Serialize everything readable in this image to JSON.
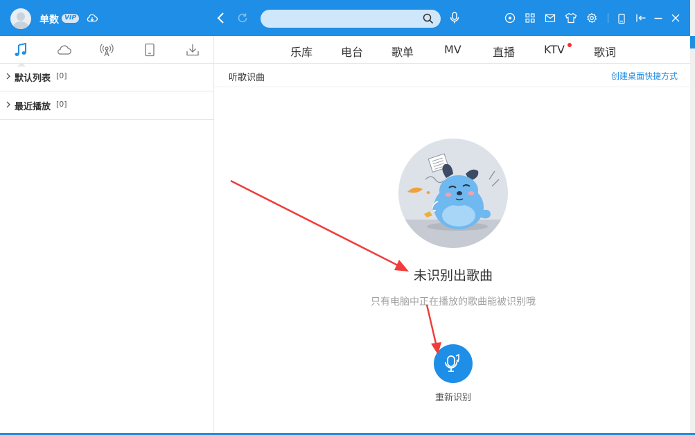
{
  "header": {
    "username": "单数",
    "vip_label": "VIP",
    "search_placeholder": "",
    "icons": [
      "avatar-icon",
      "cloud-sync-icon",
      "back-icon",
      "refresh-icon",
      "search-icon",
      "voice-search-icon",
      "disc-icon",
      "apps-icon",
      "mail-icon",
      "skin-icon",
      "settings-icon",
      "mini-mode-icon",
      "mini-player-icon",
      "minimize-icon",
      "close-icon"
    ]
  },
  "left_panel": {
    "tabs": [
      "music-note-icon",
      "cloud-icon",
      "radio-icon",
      "device-icon",
      "download-icon"
    ],
    "lists": [
      {
        "title": "默认列表",
        "count": "[0]"
      },
      {
        "title": "最近播放",
        "count": "[0]"
      }
    ]
  },
  "nav": {
    "items": [
      "乐库",
      "电台",
      "歌单",
      "MV",
      "直播",
      "KTV",
      "歌词"
    ]
  },
  "subheader": {
    "title": "听歌识曲",
    "shortcut_link": "创建桌面快捷方式"
  },
  "recognition": {
    "result_title": "未识别出歌曲",
    "hint": "只有电脑中正在播放的歌曲能被识别哦",
    "retry_label": "重新识别"
  },
  "colors": {
    "brand": "#1f8ee6",
    "annotation_arrow": "#f03c3c",
    "notification_dot": "#ff2a2a"
  }
}
